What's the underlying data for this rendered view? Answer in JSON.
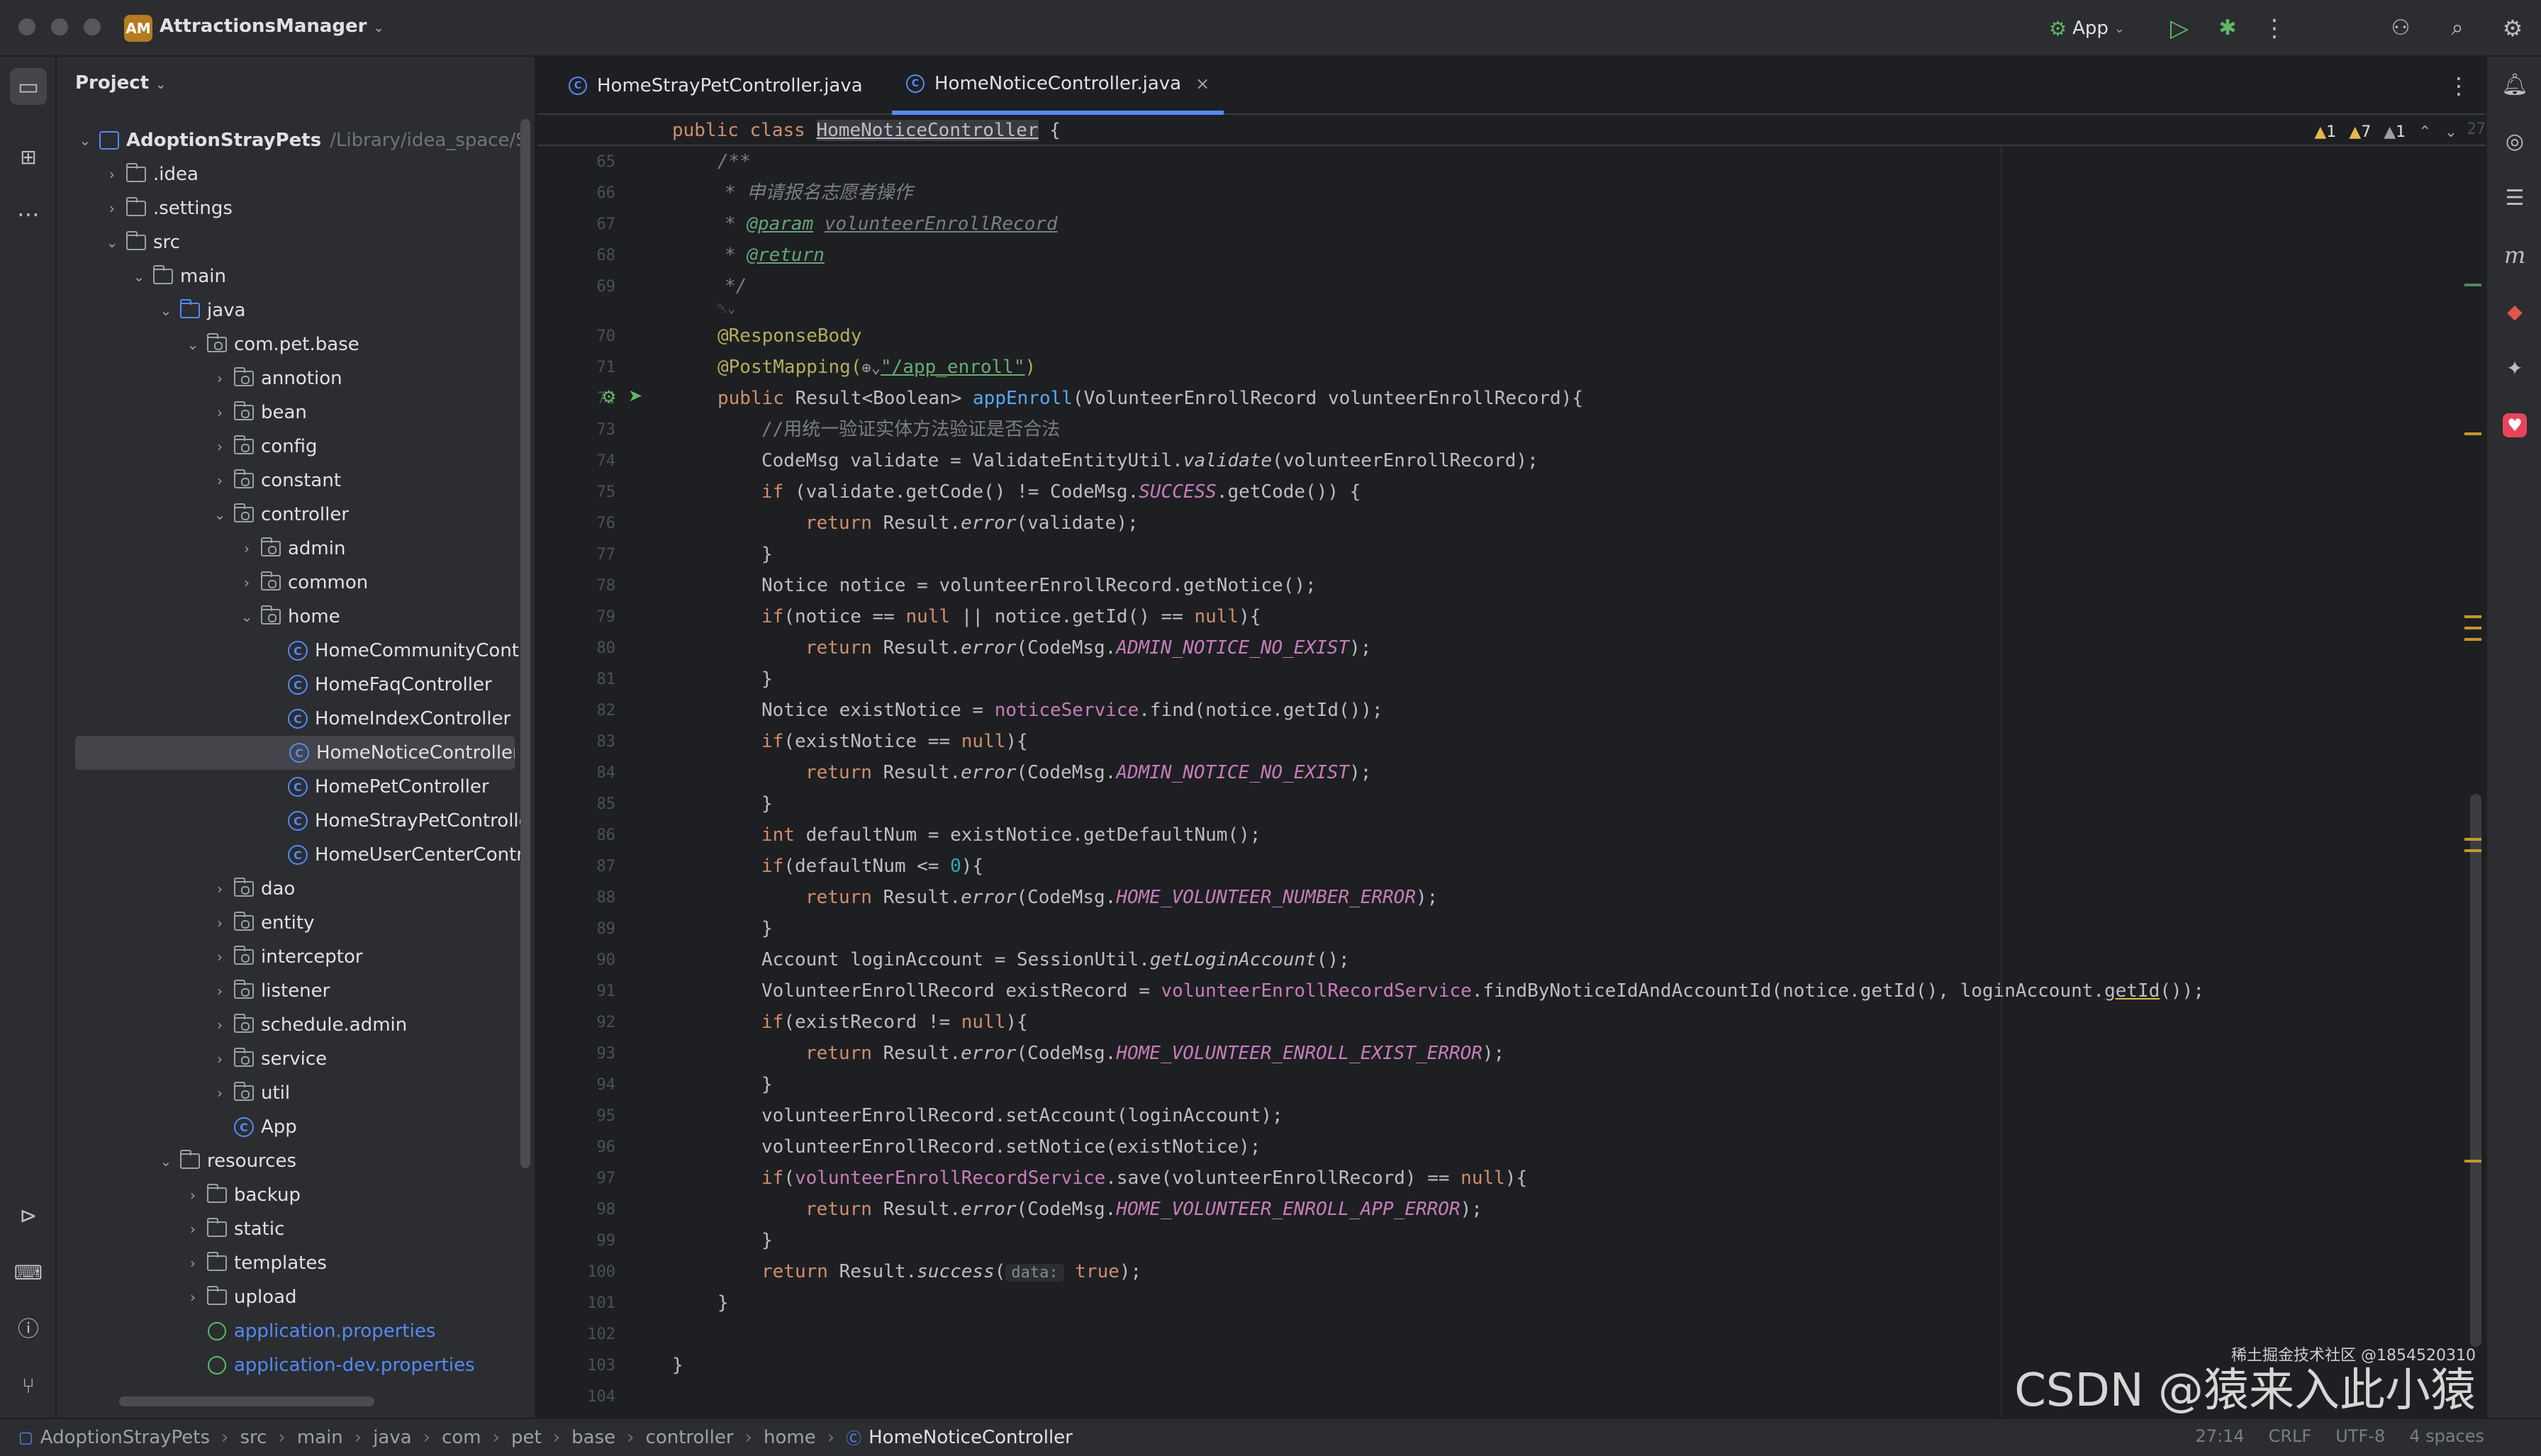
{
  "titlebar": {
    "app_badge": "AM",
    "project_name": "AttractionsManager",
    "run_config": "App",
    "icons": [
      "run-icon",
      "debug-icon",
      "more-icon",
      "add-user-icon",
      "search-icon",
      "settings-icon"
    ]
  },
  "project_panel": {
    "title": "Project",
    "root_name": "AdoptionStrayPets",
    "root_path": "/Library/idea_space/Stra",
    "tree": {
      "idea": ".idea",
      "settings": ".settings",
      "src": "src",
      "main": "main",
      "java": "java",
      "com_pet_base": "com.pet.base",
      "annotion": "annotion",
      "bean": "bean",
      "config": "config",
      "constant": "constant",
      "controller": "controller",
      "admin": "admin",
      "common": "common",
      "home": "home",
      "home_community": "HomeCommunityContr",
      "home_faq": "HomeFaqController",
      "home_index": "HomeIndexController",
      "home_notice": "HomeNoticeController",
      "home_pet": "HomePetController",
      "home_stray": "HomeStrayPetControlle",
      "home_user": "HomeUserCenterContr",
      "dao": "dao",
      "entity": "entity",
      "interceptor": "interceptor",
      "listener": "listener",
      "schedule_admin": "schedule.admin",
      "service": "service",
      "util": "util",
      "app": "App",
      "resources": "resources",
      "backup": "backup",
      "static": "static",
      "templates": "templates",
      "upload": "upload",
      "app_props": "application.properties",
      "app_dev_props": "application-dev.properties"
    }
  },
  "editor": {
    "tabs": [
      {
        "label": "HomeStrayPetController.java"
      },
      {
        "label": "HomeNoticeController.java"
      }
    ],
    "inspections": {
      "warn1": "1",
      "warn2": "7",
      "weak": "1"
    },
    "sticky": {
      "line": "27",
      "kw": "public class ",
      "name": "HomeNoticeController",
      "rest": " {"
    },
    "lines": {
      "65": "65",
      "66": "66",
      "67": "67",
      "68": "68",
      "69": "69",
      "70": "70",
      "71": "71",
      "72": "72",
      "73": "73",
      "74": "74",
      "75": "75",
      "76": "76",
      "77": "77",
      "78": "78",
      "79": "79",
      "80": "80",
      "81": "81",
      "82": "82",
      "83": "83",
      "84": "84",
      "85": "85",
      "86": "86",
      "87": "87",
      "88": "88",
      "89": "89",
      "90": "90",
      "91": "91",
      "92": "92",
      "93": "93",
      "94": "94",
      "95": "95",
      "96": "96",
      "97": "97",
      "98": "98",
      "99": "99",
      "100": "100",
      "101": "101",
      "102": "102",
      "103": "103",
      "104": "104"
    },
    "code": {
      "l65": "/**",
      "l66": "* 申请报名志愿者操作",
      "l67_tag": "@param",
      "l67_name": "volunteerEnrollRecord",
      "l68_tag": "@return",
      "l69": "*/",
      "l69b": "␡⌄",
      "l70": "@ResponseBody",
      "l71_ann": "@PostMapping(",
      "l71_str": "\"/app_enroll\"",
      "l71_end": ")",
      "l72_kw": "public ",
      "l72_type": "Result<Boolean> ",
      "l72_fn": "appEnroll",
      "l72_rest": "(VolunteerEnrollRecord volunteerEnrollRecord){",
      "l73": "//用统一验证实体方法验证是否合法",
      "l74_a": "CodeMsg validate = ValidateEntityUtil.",
      "l74_b": "validate",
      "l74_c": "(volunteerEnrollRecord);",
      "l75_a": "if ",
      "l75_b": "(validate.getCode() != CodeMsg.",
      "l75_c": "SUCCESS",
      "l75_d": ".getCode()) {",
      "l76_a": "return ",
      "l76_b": "Result.",
      "l76_c": "error",
      "l76_d": "(validate);",
      "close": "}",
      "l78": "Notice notice = volunteerEnrollRecord.getNotice();",
      "l79_a": "if",
      "l79_b": "(notice == ",
      "l79_c": "null",
      "l79_d": " || notice.getId() == ",
      "l79_e": "){",
      "l80_d": "(CodeMsg.",
      "l80_e": "ADMIN_NOTICE_NO_EXIST",
      "l80_f": ");",
      "l82_a": "Notice existNotice = ",
      "l82_b": "noticeService",
      "l82_c": ".find(notice.getId());",
      "l83_b": "(existNotice == ",
      "l86_a": "int ",
      "l86_b": "defaultNum = existNotice.getDefaultNum();",
      "l87_b": "(defaultNum <= ",
      "l87_c": "0",
      "l87_d": "){",
      "l88_e": "HOME_VOLUNTEER_NUMBER_ERROR",
      "l90_a": "Account loginAccount = SessionUtil.",
      "l90_b": "getLoginAccount",
      "l90_c": "();",
      "l91_a": "VolunteerEnrollRecord existRecord = ",
      "l91_b": "volunteerEnrollRecordService",
      "l91_c": ".findByNoticeIdAndAccountId(notice.getId(), loginAccount.",
      "l91_d": "getId",
      "l91_e": "());",
      "l92_b": "(existRecord != ",
      "l93_e": "HOME_VOLUNTEER_ENROLL_EXIST_ERROR",
      "l95": "volunteerEnrollRecord.setAccount(loginAccount);",
      "l96": "volunteerEnrollRecord.setNotice(existNotice);",
      "l97_b": "(",
      "l97_c": "volunteerEnrollRecordService",
      "l97_d": ".save(volunteerEnrollRecord) == ",
      "l98_e": "HOME_VOLUNTEER_ENROLL_APP_ERROR",
      "l100_c": "success",
      "l100_d": "(",
      "l100_hint": "data:",
      "l100_e": " true",
      "l100_f": ");"
    },
    "watermark": "CSDN @猿来入此小猿",
    "watermark_small": "稀土掘金技术社区 @1854520310"
  },
  "statusbar": {
    "crumbs": [
      "AdoptionStrayPets",
      "src",
      "main",
      "java",
      "com",
      "pet",
      "base",
      "controller",
      "home",
      "HomeNoticeController"
    ],
    "position": "27:14",
    "line_sep": "CRLF",
    "encoding": "UTF-8",
    "indent": "4 spaces"
  }
}
